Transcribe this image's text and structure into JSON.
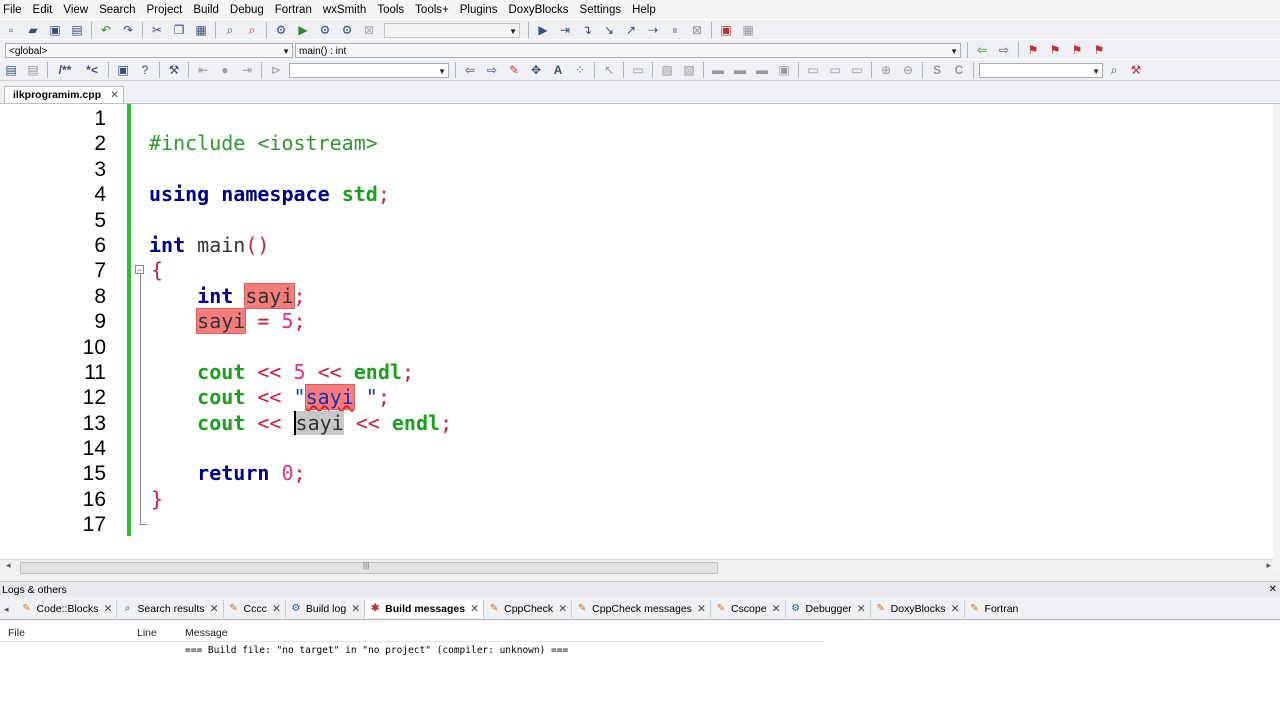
{
  "menu": [
    "File",
    "Edit",
    "View",
    "Search",
    "Project",
    "Build",
    "Debug",
    "Fortran",
    "wxSmith",
    "Tools",
    "Tools+",
    "Plugins",
    "DoxyBlocks",
    "Settings",
    "Help"
  ],
  "scope_combo": "<global>",
  "function_combo": "main() : int",
  "tab": {
    "filename": "ilkprogramim.cpp",
    "close": "✕"
  },
  "editor": {
    "line_numbers": [
      "1",
      "2",
      "3",
      "4",
      "5",
      "6",
      "7",
      "8",
      "9",
      "10",
      "11",
      "12",
      "13",
      "14",
      "15",
      "16",
      "17"
    ],
    "tokens": {
      "include": "#include <iostream>",
      "using": "using",
      "namespace": "namespace",
      "std": "std",
      "semi": ";",
      "int": "int",
      "main": "main",
      "parens": "()",
      "lbrace": "{",
      "rbrace": "}",
      "sayi": "sayi",
      "eq": "=",
      "five": "5",
      "cout": "cout",
      "shl": "<<",
      "endl": "endl",
      "quote": "\"",
      "str_tail": " \"",
      "return": "return",
      "zero": "0"
    }
  },
  "logs": {
    "title": "Logs & others",
    "tabs": [
      {
        "label": "Code::Blocks",
        "icon": "page-icon"
      },
      {
        "label": "Search results",
        "icon": "search-icon"
      },
      {
        "label": "Cccc",
        "icon": "page-icon"
      },
      {
        "label": "Build log",
        "icon": "gear-icon"
      },
      {
        "label": "Build messages",
        "icon": "build-icon"
      },
      {
        "label": "CppCheck",
        "icon": "page-icon"
      },
      {
        "label": "CppCheck messages",
        "icon": "page-icon"
      },
      {
        "label": "Cscope",
        "icon": "page-icon"
      },
      {
        "label": "Debugger",
        "icon": "gear-icon"
      },
      {
        "label": "DoxyBlocks",
        "icon": "page-icon"
      },
      {
        "label": "Fortran",
        "icon": "page-icon"
      }
    ],
    "active_tab": "Build messages",
    "columns": {
      "file": "File",
      "line": "Line",
      "message": "Message"
    },
    "message": "=== Build file: \"no target\" in \"no project\" (compiler: unknown) ==="
  }
}
